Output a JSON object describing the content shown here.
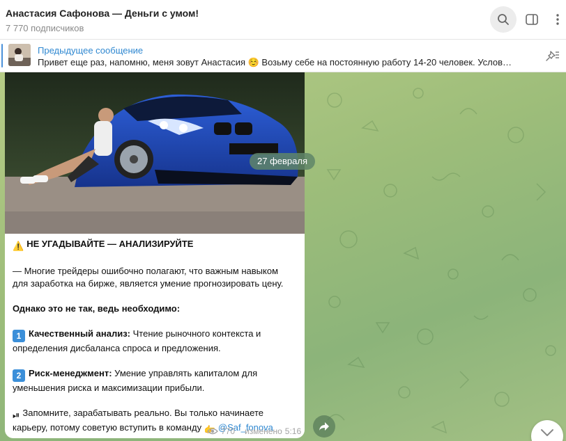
{
  "header": {
    "title": "Анастасия Сафонова — Деньги с умом!",
    "subtitle": "7 770 подписчиков",
    "icons": [
      "search-icon",
      "sidebar-icon",
      "more-icon"
    ]
  },
  "pinned": {
    "title": "Предыдущее сообщение",
    "text": "Привет еще раз, напомню, меня зовут Анастасия ☺️  Возьму себе на постоянную работу 14-20 человек.   Услов…",
    "icon": "unpin-icon"
  },
  "message": {
    "date": "27 февраля",
    "heading_emoji": "⚠️",
    "heading": "НЕ УГАДЫВАЙТЕ — АНАЛИЗИРУЙТЕ",
    "intro_1": "— Многие трейдеры ошибочно полагают, что важным навыком",
    "intro_2": "для заработка на бирже, является умение прогнозировать цену.",
    "however": "Однако это не так, ведь необходимо:",
    "item1_num": "1",
    "item1_title": "Качественный анализ:",
    "item1_text_1": " Чтение рыночного контекста и",
    "item1_text_2": "определения дисбаланса спроса и предложения.",
    "item2_num": "2",
    "item2_title": "Риск-менеджмент:",
    "item2_text_1": " Умение управлять капиталом для",
    "item2_text_2": "уменьшения риска и максимизации прибыли.",
    "closing_emoji": "⏯",
    "closing_1": "Запомните, зарабатывать реально. Вы только начинаете",
    "closing_2": "карьеру, потому советую вступить в команду ",
    "pointing_emoji": "👉",
    "link": "@Saf_fonova",
    "views": "770",
    "edited": "изменено",
    "time": "5:16"
  },
  "colors": {
    "accent": "#2f88d1",
    "chat_bg": "#9dbd7a"
  }
}
